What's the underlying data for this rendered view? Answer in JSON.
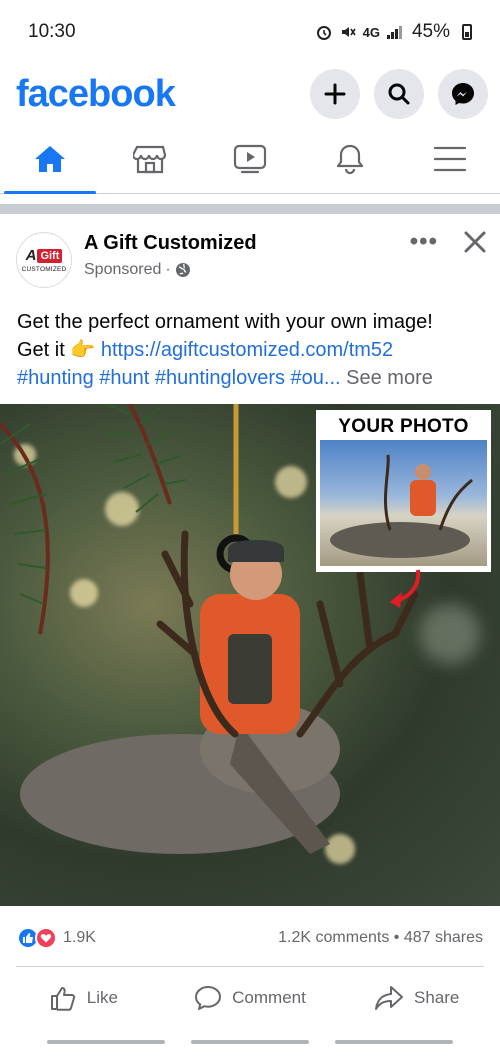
{
  "status_bar": {
    "time": "10:30",
    "network": "4G",
    "battery": "45%"
  },
  "header": {
    "logo": "facebook",
    "buttons": [
      "plus-icon",
      "search-icon",
      "messenger-icon"
    ]
  },
  "nav": {
    "tabs": [
      {
        "name": "home",
        "icon": "home-icon",
        "active": true
      },
      {
        "name": "marketplace",
        "icon": "marketplace-icon",
        "active": false
      },
      {
        "name": "video",
        "icon": "video-icon",
        "active": false
      },
      {
        "name": "notifications",
        "icon": "bell-icon",
        "active": false
      },
      {
        "name": "menu",
        "icon": "hamburger-icon",
        "active": false
      }
    ]
  },
  "post": {
    "page_name": "A Gift Customized",
    "avatar": {
      "letter": "A",
      "badge": "Gift",
      "sub": "CUSTOMIZED"
    },
    "sponsored": "Sponsored",
    "text_line1": "Get the perfect ornament with your own image!",
    "text_line2_prefix": "Get it",
    "pointing_emoji": "👉",
    "link": "https://agiftcustomized.com/tm52",
    "hashtags": "#hunting #hunt #huntinglovers #ou...",
    "see_more": "See more",
    "image": {
      "overlay_label": "YOUR PHOTO"
    },
    "reactions": {
      "count": "1.9K",
      "comments": "1.2K comments",
      "shares": "487 shares",
      "separator": "•"
    },
    "actions": {
      "like": "Like",
      "comment": "Comment",
      "share": "Share"
    }
  },
  "colors": {
    "brand": "#1877f2",
    "link": "#216fdb",
    "secondary_text": "#65676b",
    "love": "#f33e58"
  }
}
